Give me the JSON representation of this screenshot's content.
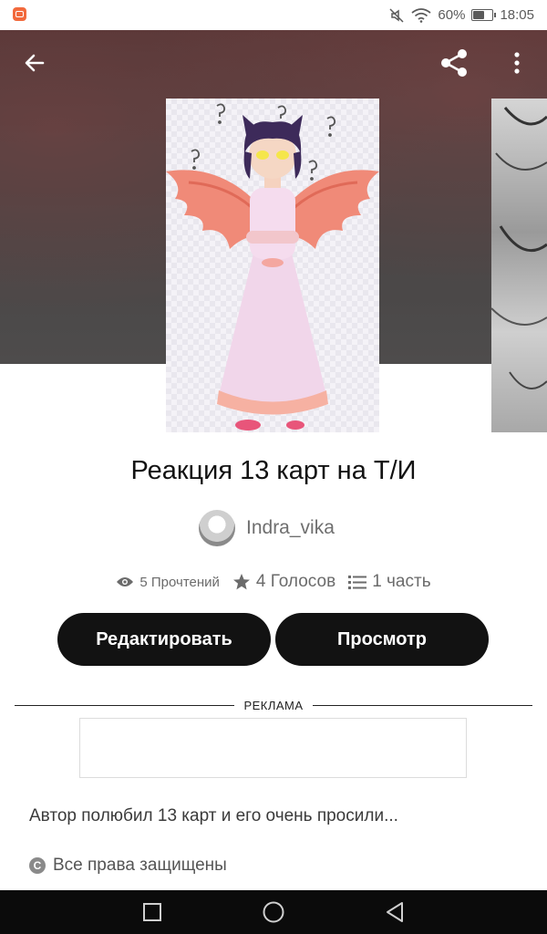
{
  "status_bar": {
    "battery_percent": "60%",
    "time": "18:05",
    "battery_level": 0.6
  },
  "story": {
    "title": "Реакция 13 карт на Т/И",
    "author": "Indra_vika",
    "stats": {
      "reads": "5 Прочтений",
      "votes": "4 Голосов",
      "parts": "1 часть"
    },
    "description": "Автор полюбил 13 карт и его очень просили...",
    "rights": "Все права защищены"
  },
  "buttons": {
    "edit": "Редактировать",
    "view": "Просмотр"
  },
  "ad": {
    "label": "РЕКЛАМА"
  },
  "colors": {
    "button_bg": "#121212",
    "text_primary": "#121212",
    "text_secondary": "#6b6b6b",
    "nav_bg": "#0b0b0b"
  }
}
